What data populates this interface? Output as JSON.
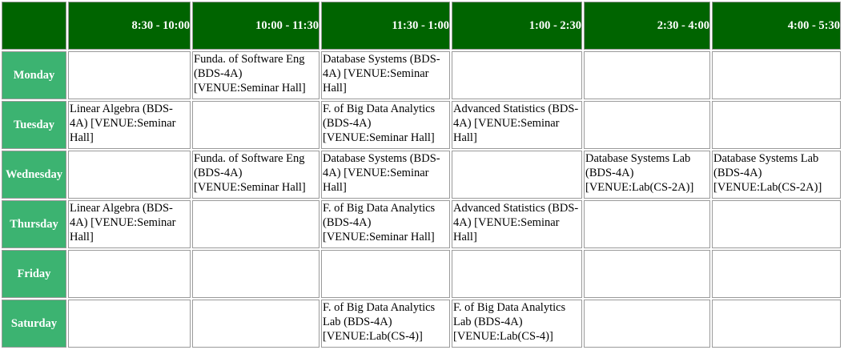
{
  "timetable": {
    "time_slots": [
      "8:30 - 10:00",
      "10:00 - 11:30",
      "11:30 - 1:00",
      "1:00 - 2:30",
      "2:30 - 4:00",
      "4:00 - 5:30"
    ],
    "rows": [
      {
        "day": "Monday",
        "cells": [
          "",
          "Funda. of Software Eng (BDS-4A) [VENUE:Seminar Hall]",
          "Database Systems (BDS-4A) [VENUE:Seminar Hall]",
          "",
          "",
          ""
        ]
      },
      {
        "day": "Tuesday",
        "cells": [
          "Linear Algebra (BDS-4A) [VENUE:Seminar Hall]",
          "",
          "F. of Big Data Analytics (BDS-4A) [VENUE:Seminar Hall]",
          "Advanced Statistics (BDS-4A) [VENUE:Seminar Hall]",
          "",
          ""
        ]
      },
      {
        "day": "Wednesday",
        "cells": [
          "",
          "Funda. of Software Eng (BDS-4A) [VENUE:Seminar Hall]",
          "Database Systems (BDS-4A) [VENUE:Seminar Hall]",
          "",
          "Database Systems Lab (BDS-4A) [VENUE:Lab(CS-2A)]",
          "Database Systems Lab (BDS-4A) [VENUE:Lab(CS-2A)]"
        ]
      },
      {
        "day": "Thursday",
        "cells": [
          "Linear Algebra (BDS-4A) [VENUE:Seminar Hall]",
          "",
          "F. of Big Data Analytics (BDS-4A) [VENUE:Seminar Hall]",
          "Advanced Statistics (BDS-4A) [VENUE:Seminar Hall]",
          "",
          ""
        ]
      },
      {
        "day": "Friday",
        "cells": [
          "",
          "",
          "",
          "",
          "",
          ""
        ]
      },
      {
        "day": "Saturday",
        "cells": [
          "",
          "",
          "F. of Big Data Analytics Lab (BDS-4A) [VENUE:Lab(CS-4)]",
          "F. of Big Data Analytics Lab (BDS-4A) [VENUE:Lab(CS-4)]",
          "",
          ""
        ]
      }
    ]
  },
  "colors": {
    "header_bg": "#006400",
    "day_bg": "#3cb371",
    "header_text": "#ffffff"
  }
}
